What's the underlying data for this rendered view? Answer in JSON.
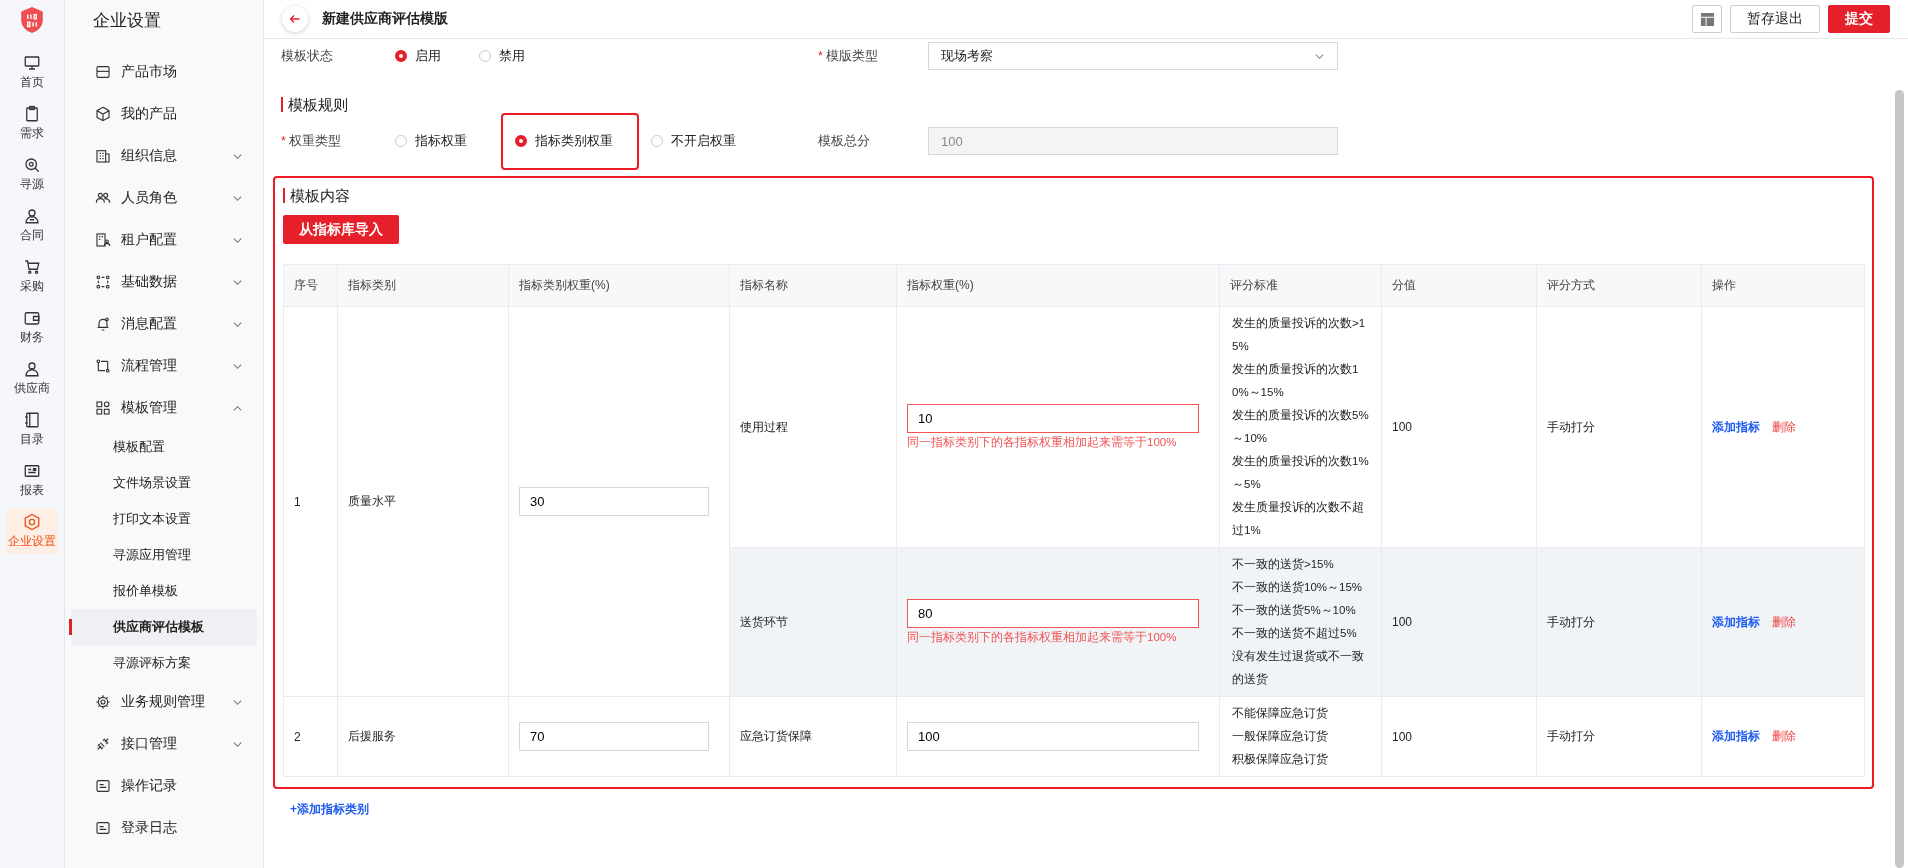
{
  "rail": [
    {
      "label": "首页",
      "selected": false
    },
    {
      "label": "需求",
      "selected": false
    },
    {
      "label": "寻源",
      "selected": false
    },
    {
      "label": "合同",
      "selected": false
    },
    {
      "label": "采购",
      "selected": false
    },
    {
      "label": "财务",
      "selected": false
    },
    {
      "label": "供应商",
      "selected": false
    },
    {
      "label": "目录",
      "selected": false
    },
    {
      "label": "报表",
      "selected": false
    },
    {
      "label": "企业设置",
      "selected": true
    }
  ],
  "sidebar": {
    "title": "企业设置",
    "items": [
      {
        "label": "产品市场",
        "kind": "link"
      },
      {
        "label": "我的产品",
        "kind": "link"
      },
      {
        "label": "组织信息",
        "kind": "group",
        "expanded": false
      },
      {
        "label": "人员角色",
        "kind": "group",
        "expanded": false
      },
      {
        "label": "租户配置",
        "kind": "group",
        "expanded": false
      },
      {
        "label": "基础数据",
        "kind": "group",
        "expanded": false
      },
      {
        "label": "消息配置",
        "kind": "group",
        "expanded": false
      },
      {
        "label": "流程管理",
        "kind": "group",
        "expanded": false
      },
      {
        "label": "模板管理",
        "kind": "group",
        "expanded": true,
        "children": [
          {
            "label": "模板配置",
            "selected": false
          },
          {
            "label": "文件场景设置",
            "selected": false
          },
          {
            "label": "打印文本设置",
            "selected": false
          },
          {
            "label": "寻源应用管理",
            "selected": false
          },
          {
            "label": "报价单模板",
            "selected": false
          },
          {
            "label": "供应商评估模板",
            "selected": true
          },
          {
            "label": "寻源评标方案",
            "selected": false
          }
        ]
      },
      {
        "label": "业务规则管理",
        "kind": "group",
        "expanded": false
      },
      {
        "label": "接口管理",
        "kind": "group",
        "expanded": false
      },
      {
        "label": "操作记录",
        "kind": "link"
      },
      {
        "label": "登录日志",
        "kind": "link"
      }
    ]
  },
  "header": {
    "title": "新建供应商评估模版",
    "buttons": [
      {
        "label": "暂存退出",
        "kind": "default"
      },
      {
        "label": "提交",
        "kind": "primary"
      }
    ]
  },
  "status": {
    "label": "模板状态",
    "options": [
      {
        "label": "启用",
        "selected": true
      },
      {
        "label": "禁用",
        "selected": false
      }
    ]
  },
  "template_type": {
    "label": "模版类型",
    "required_mark": "*",
    "value": "现场考察"
  },
  "rules": {
    "title": "模板规则",
    "weight_type": {
      "label": "权重类型",
      "required_mark": "*",
      "options": [
        {
          "label": "指标权重",
          "selected": false,
          "highlighted": false
        },
        {
          "label": "指标类别权重",
          "selected": true,
          "highlighted": true
        },
        {
          "label": "不开启权重",
          "selected": false,
          "highlighted": false
        }
      ]
    },
    "total": {
      "label": "模板总分",
      "value": "100",
      "disabled": true
    }
  },
  "content": {
    "title": "模板内容",
    "highlighted": true,
    "import_button": "从指标库导入",
    "columns": [
      "序号",
      "指标类别",
      "指标类别权重(%)",
      "指标名称",
      "指标权重(%)",
      "评分标准",
      "分值",
      "评分方式",
      "操作"
    ],
    "categories": [
      {
        "index": "1",
        "name": "质量水平",
        "weight": "30",
        "indicators": [
          {
            "name": "使用过程",
            "weight": "10",
            "error": "同一指标类别下的各指标权重相加起来需等于100%",
            "hovered": false,
            "criteria": [
              "发生的质量投诉的次数>15%",
              "发生的质量投诉的次数10%～15%",
              "发生的质量投诉的次数5%～10%",
              "发生的质量投诉的次数1%～5%",
              "发生质量投诉的次数不超过1%"
            ],
            "score": "100",
            "method": "手动打分",
            "actions": [
              {
                "label": "添加指标",
                "kind": "add"
              },
              {
                "label": "删除",
                "kind": "delete"
              }
            ]
          },
          {
            "name": "送货环节",
            "weight": "80",
            "error": "同一指标类别下的各指标权重相加起来需等于100%",
            "hovered": true,
            "criteria": [
              "不一致的送货>15%",
              "不一致的送货10%～15%",
              "不一致的送货5%～10%",
              "不一致的送货不超过5%",
              "没有发生过退货或不一致的送货"
            ],
            "score": "100",
            "method": "手动打分",
            "actions": [
              {
                "label": "添加指标",
                "kind": "add"
              },
              {
                "label": "删除",
                "kind": "delete"
              }
            ]
          }
        ]
      },
      {
        "index": "2",
        "name": "后援服务",
        "weight": "70",
        "indicators": [
          {
            "name": "应急订货保障",
            "weight": "100",
            "hovered": false,
            "criteria": [
              "不能保障应急订货",
              "一般保障应急订货",
              "积极保障应急订货"
            ],
            "score": "100",
            "method": "手动打分",
            "actions": [
              {
                "label": "添加指标",
                "kind": "add"
              },
              {
                "label": "删除",
                "kind": "delete"
              }
            ]
          }
        ]
      }
    ],
    "add_category": "+添加指标类别"
  }
}
